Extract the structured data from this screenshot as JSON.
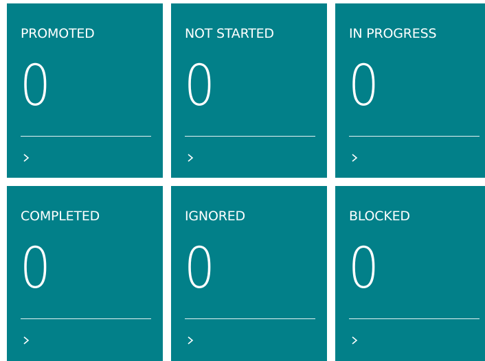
{
  "tiles": [
    {
      "label": "PROMOTED",
      "count": "0",
      "icon": "chevron-right-icon"
    },
    {
      "label": "NOT STARTED",
      "count": "0",
      "icon": "chevron-right-icon"
    },
    {
      "label": "IN PROGRESS",
      "count": "0",
      "icon": "chevron-right-icon"
    },
    {
      "label": "COMPLETED",
      "count": "0",
      "icon": "chevron-right-icon"
    },
    {
      "label": "IGNORED",
      "count": "0",
      "icon": "chevron-right-icon"
    },
    {
      "label": "BLOCKED",
      "count": "0",
      "icon": "chevron-right-icon"
    }
  ],
  "colors": {
    "tile_background": "#028089",
    "tile_text": "#ffffff",
    "page_background": "#ffffff"
  }
}
